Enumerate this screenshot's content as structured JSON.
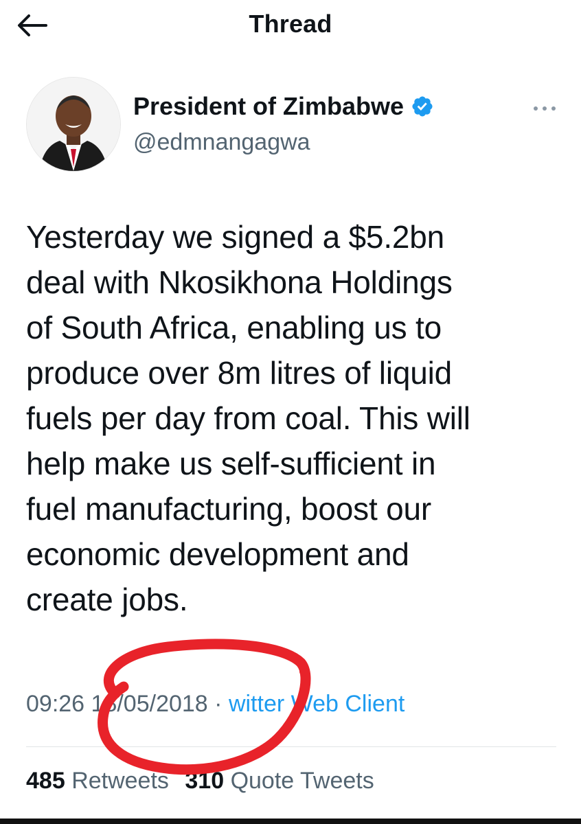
{
  "header": {
    "title": "Thread",
    "back_icon": "arrow-left-icon"
  },
  "author": {
    "display_name": "President of Zimbabwe",
    "handle": "@edmnangagwa",
    "verified": true,
    "verified_color": "#1d9bf0"
  },
  "tweet": {
    "text": "Yesterday we signed a $5.2bn\ndeal with Nkosikhona Holdings\nof South Africa, enabling us to\nproduce over 8m litres of liquid\nfuels per day from coal. This will\nhelp make us self-sufficient in\nfuel manufacturing, boost our\neconomic development and\ncreate jobs."
  },
  "meta": {
    "time": "09:26",
    "date": "18/05/2018",
    "separator": "·",
    "client": "witter Web Client"
  },
  "stats": {
    "retweets_count": "485",
    "retweets_label": "Retweets",
    "quotes_count": "310",
    "quotes_label": "Quote Tweets"
  },
  "colors": {
    "accent": "#1d9bf0",
    "secondary_text": "#536471",
    "annotation": "#e8232a"
  }
}
